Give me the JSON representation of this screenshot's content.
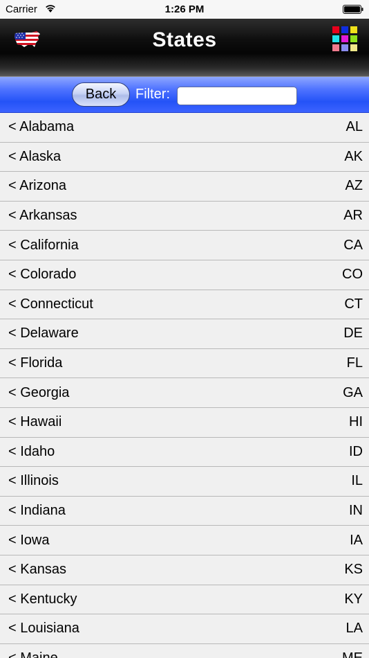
{
  "status_bar": {
    "carrier": "Carrier",
    "time": "1:26 PM"
  },
  "nav_bar": {
    "title": "States",
    "left_icon": "us-flag-map-icon",
    "right_icon": "color-grid-icon",
    "grid_colors": [
      "#e8001c",
      "#0f2de0",
      "#f0e21a",
      "#22e0e8",
      "#e11ad8",
      "#8fe31a",
      "#f07a8e",
      "#8a8cf0",
      "#f0e88a"
    ]
  },
  "filter_bar": {
    "back_label": "Back",
    "filter_label": "Filter:",
    "filter_value": ""
  },
  "states": [
    {
      "name": "< Alabama",
      "abbr": "AL"
    },
    {
      "name": "< Alaska",
      "abbr": "AK"
    },
    {
      "name": "< Arizona",
      "abbr": "AZ"
    },
    {
      "name": "< Arkansas",
      "abbr": "AR"
    },
    {
      "name": "< California",
      "abbr": "CA"
    },
    {
      "name": "< Colorado",
      "abbr": "CO"
    },
    {
      "name": "< Connecticut",
      "abbr": "CT"
    },
    {
      "name": "< Delaware",
      "abbr": "DE"
    },
    {
      "name": "< Florida",
      "abbr": "FL"
    },
    {
      "name": "< Georgia",
      "abbr": "GA"
    },
    {
      "name": "< Hawaii",
      "abbr": "HI"
    },
    {
      "name": "< Idaho",
      "abbr": "ID"
    },
    {
      "name": "< Illinois",
      "abbr": "IL"
    },
    {
      "name": "< Indiana",
      "abbr": "IN"
    },
    {
      "name": "< Iowa",
      "abbr": "IA"
    },
    {
      "name": "< Kansas",
      "abbr": "KS"
    },
    {
      "name": "< Kentucky",
      "abbr": "KY"
    },
    {
      "name": "< Louisiana",
      "abbr": "LA"
    },
    {
      "name": "< Maine",
      "abbr": "ME"
    }
  ]
}
